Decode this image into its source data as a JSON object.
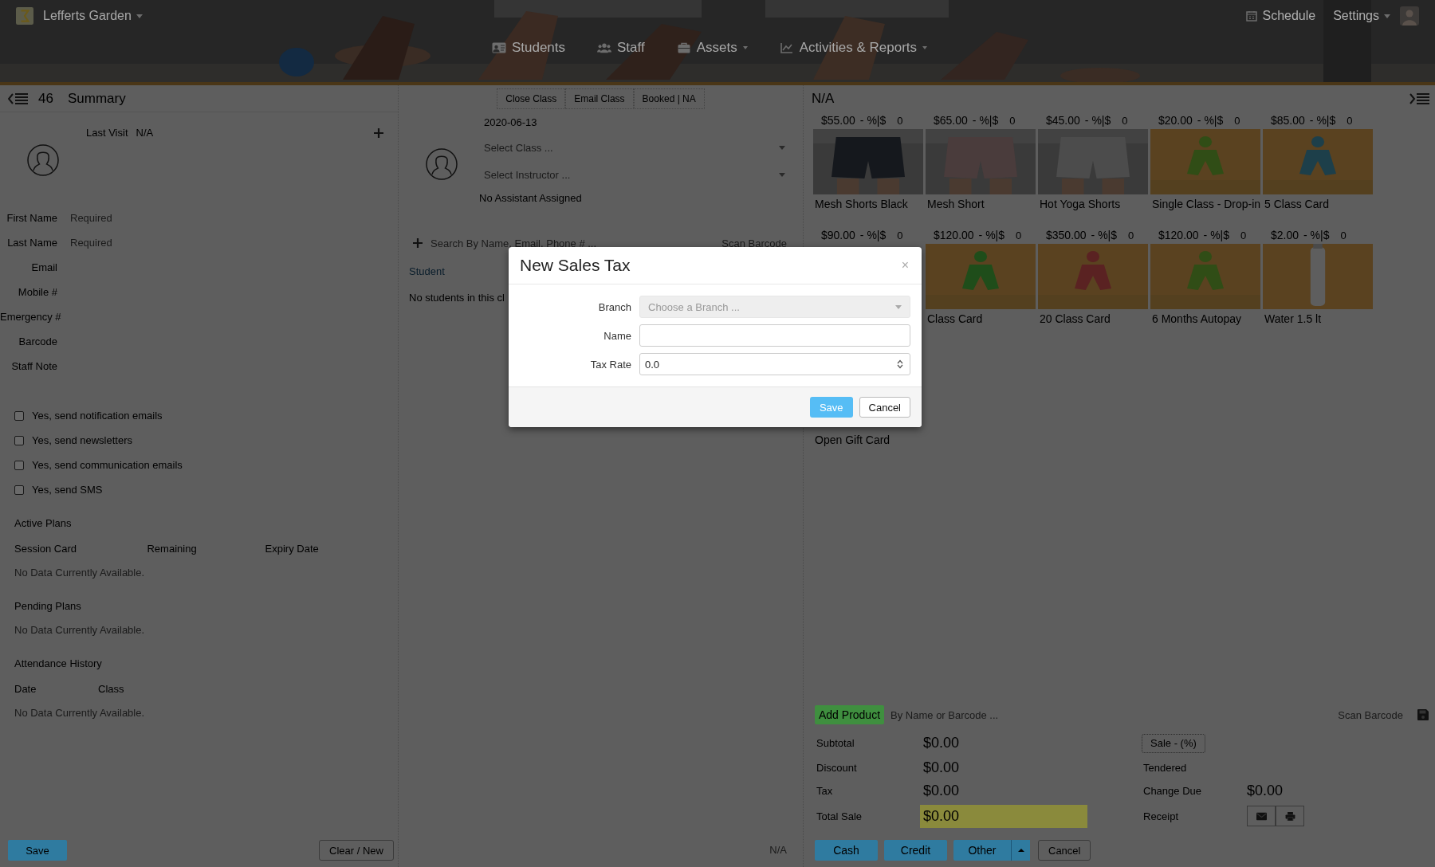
{
  "header": {
    "brand": "Lefferts Garden",
    "schedule": "Schedule",
    "settings": "Settings"
  },
  "nav": {
    "students": "Students",
    "staff": "Staff",
    "assets": "Assets",
    "reports": "Activities & Reports"
  },
  "summary_panel": {
    "count": "46",
    "title": "Summary",
    "last_visit_label": "Last Visit",
    "last_visit": "N/A",
    "fields": [
      {
        "label": "First Name",
        "placeholder": "Required"
      },
      {
        "label": "Last Name",
        "placeholder": "Required"
      },
      {
        "label": "Email"
      },
      {
        "label": "Mobile #"
      },
      {
        "label": "Emergency #"
      },
      {
        "label": "Barcode"
      },
      {
        "label": "Staff Note"
      }
    ],
    "options": [
      {
        "label": "Yes, send notification emails",
        "checked": false
      },
      {
        "label": "Yes, send newsletters",
        "checked": false
      },
      {
        "label": "Yes, send communication emails",
        "checked": false
      },
      {
        "label": "Yes, send SMS",
        "checked": false
      }
    ],
    "sections": [
      {
        "title": "Active Plans",
        "columns": [
          "Session Card",
          "Remaining",
          "Expiry Date"
        ],
        "empty": "No Data Currently Available."
      },
      {
        "title": "Pending Plans",
        "empty": "No Data Currently Available."
      },
      {
        "title": "Attendance History",
        "columns": [
          "Date",
          "Class"
        ],
        "empty": "No Data Currently Available."
      }
    ],
    "save": "Save",
    "clear": "Clear / New"
  },
  "class_panel": {
    "actions": [
      "Close Class",
      "Email Class",
      "Booked | NA"
    ],
    "date": "2020-06-13",
    "class_select": {
      "placeholder": "Select Class ..."
    },
    "instructor_select": {
      "placeholder": "Select Instructor ..."
    },
    "assistant": "No Assistant Assigned",
    "search": {
      "placeholder": "Search By Name, Email, Phone # ..."
    },
    "scan": "Scan Barcode",
    "column": "Student",
    "empty": "No students in this cl",
    "footer": "N/A"
  },
  "sale_panel": {
    "title": "N/A",
    "products": [
      {
        "price": "$55.00",
        "discount": "- %|$",
        "quantity": "0",
        "name": "Mesh Shorts Black"
      },
      {
        "price": "$65.00",
        "discount": "- %|$",
        "quantity": "0",
        "name": "Mesh Short"
      },
      {
        "price": "$45.00",
        "discount": "- %|$",
        "quantity": "0",
        "name": "Hot Yoga Shorts"
      },
      {
        "price": "$20.00",
        "discount": "- %|$",
        "quantity": "0",
        "name": "Single Class - Drop-in"
      },
      {
        "price": "$85.00",
        "discount": "- %|$",
        "quantity": "0",
        "name": "5 Class Card"
      },
      {
        "price": "$90.00",
        "discount": "- %|$",
        "quantity": "0"
      },
      {
        "price": "$120.00",
        "discount": "- %|$",
        "quantity": "0",
        "name": "Class Card"
      },
      {
        "price": "$350.00",
        "discount": "- %|$",
        "quantity": "0",
        "name": "20 Class Card"
      },
      {
        "price": "$120.00",
        "discount": "- %|$",
        "quantity": "0",
        "name": "6 Months Autopay"
      },
      {
        "price": "$2.00",
        "discount": "- %|$",
        "quantity": "0",
        "name": "Water 1.5 lt"
      }
    ],
    "gift": "Open Gift Card",
    "add_product": "Add Product",
    "search": {
      "placeholder": "By Name or Barcode ..."
    },
    "scan": "Scan Barcode",
    "totals": [
      {
        "label": "Subtotal",
        "value": "$0.00",
        "highlighted": false
      },
      {
        "label": "Discount",
        "value": "$0.00",
        "highlighted": false
      },
      {
        "label": "Tax",
        "value": "$0.00",
        "highlighted": false
      },
      {
        "label": "Total Sale",
        "value": "$0.00",
        "highlighted": true
      }
    ],
    "sale_button": "Sale - (%)",
    "tendered": "Tendered",
    "change_due_label": "Change Due",
    "change_due": "$0.00",
    "receipt": "Receipt",
    "payments": [
      "Cash",
      "Credit",
      "Other"
    ],
    "cancel": "Cancel"
  },
  "modal": {
    "title": "New Sales Tax",
    "close": "×",
    "fields": [
      {
        "label": "Branch",
        "kind": "select",
        "placeholder": "Choose a Branch ..."
      },
      {
        "label": "Name",
        "kind": "text"
      },
      {
        "label": "Tax Rate",
        "kind": "number",
        "value": "0.0"
      }
    ],
    "save": "Save",
    "cancel": "Cancel"
  }
}
